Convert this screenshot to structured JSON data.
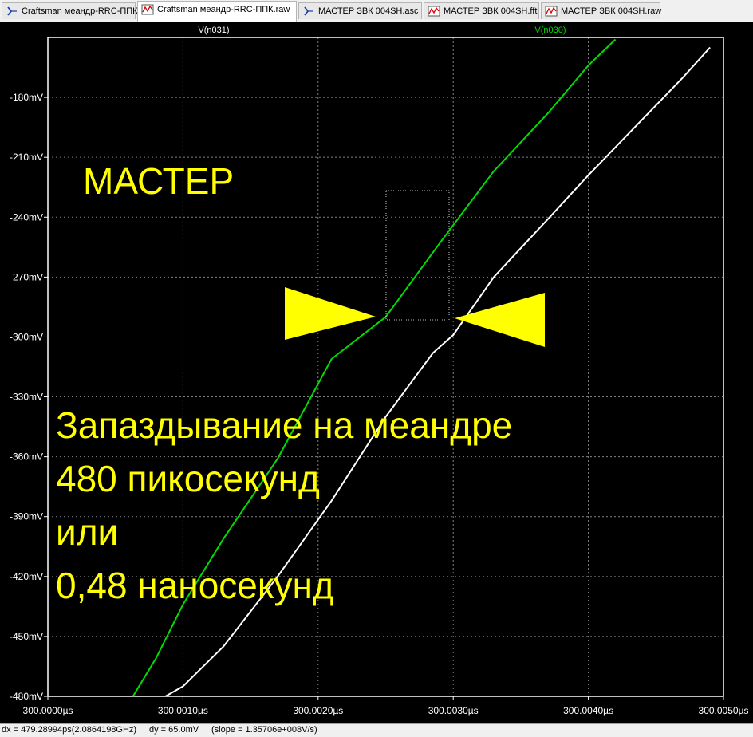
{
  "tabs": [
    {
      "label": "Craftsman меандр-RRC-ППК.asc",
      "icon": "schematic-icon",
      "active": false
    },
    {
      "label": "Craftsman меандр-RRC-ППК.raw",
      "icon": "waveform-icon",
      "active": true
    },
    {
      "label": "МАСТЕР ЗВК 004SH.asc",
      "icon": "schematic-icon",
      "active": false
    },
    {
      "label": "МАСТЕР ЗВК 004SH.fft",
      "icon": "waveform-icon",
      "active": false
    },
    {
      "label": "МАСТЕР ЗВК 004SH.raw",
      "icon": "waveform-icon",
      "active": false
    }
  ],
  "status": {
    "dx": "dx = 479.28994ps(2.0864198GHz)",
    "dy": "dy = 65.0mV",
    "slope": "(slope = 1.35706e+008V/s)"
  },
  "annotations": {
    "brand": "МАСТЕР",
    "line1": "Запаздывание на меандре",
    "line2": "480 пикосекунд",
    "line3": "или",
    "line4": "0,48 наносекунд"
  },
  "colors": {
    "background": "#000000",
    "grid": "#808080",
    "trace_green": "#00dd00",
    "trace_white": "#ffffff",
    "annotation": "#ffff00"
  },
  "chart_data": {
    "type": "line",
    "xlim": [
      300.0,
      300.005
    ],
    "ylim": [
      -480,
      -150
    ],
    "x_ticks": [
      300.0,
      300.001,
      300.002,
      300.003,
      300.004,
      300.005
    ],
    "x_tick_labels": [
      "300.0000µs",
      "300.0010µs",
      "300.0020µs",
      "300.0030µs",
      "300.0040µs",
      "300.0050µs"
    ],
    "y_ticks": [
      -180,
      -210,
      -240,
      -270,
      -300,
      -330,
      -360,
      -390,
      -420,
      -450,
      -480
    ],
    "y_tick_labels": [
      "-180mV",
      "-210mV",
      "-240mV",
      "-270mV",
      "-300mV",
      "-330mV",
      "-360mV",
      "-390mV",
      "-420mV",
      "-450mV",
      "-480mV"
    ],
    "grid": true,
    "series": [
      {
        "name": "V(n031)",
        "color": "#00dd00",
        "label_position": "top-left",
        "x": [
          300.00063,
          300.0008,
          300.001,
          300.0013,
          300.0017,
          300.0021,
          300.0025,
          300.0029,
          300.0033,
          300.0037,
          300.004,
          300.0042
        ],
        "y": [
          -480,
          -461,
          -434,
          -401,
          -361,
          -311,
          -290,
          -253,
          -217,
          -188,
          -164,
          -151
        ]
      },
      {
        "name": "V(n030)",
        "color": "#ffffff",
        "label_position": "top-right",
        "x": [
          300.00087,
          300.001,
          300.0013,
          300.0017,
          300.0021,
          300.0025,
          300.00285,
          300.003,
          300.0033,
          300.0037,
          300.004,
          300.0044,
          300.0047,
          300.0049
        ],
        "y": [
          -480,
          -475,
          -455,
          -420,
          -382,
          -340,
          -308,
          -299,
          -270,
          -241,
          -219,
          -191,
          -170,
          -155
        ]
      }
    ]
  }
}
